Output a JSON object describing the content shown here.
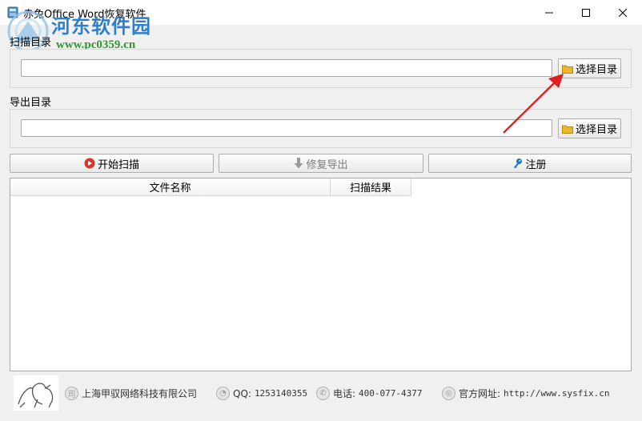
{
  "window": {
    "title": "赤兔Office Word恢复软件",
    "controls": {
      "minimize": "—",
      "maximize": "☐",
      "close": "✕"
    }
  },
  "watermark": {
    "site_name": "河东软件园",
    "site_url": "www.pc0359.cn"
  },
  "scan_dir": {
    "label": "扫描目录",
    "value": "",
    "browse_label": "选择目录"
  },
  "export_dir": {
    "label": "导出目录",
    "value": "",
    "browse_label": "选择目录"
  },
  "actions": {
    "start_scan": "开始扫描",
    "repair_export": "修复导出",
    "register": "注册"
  },
  "table": {
    "columns": [
      "文件名称",
      "扫描结果"
    ],
    "rows": []
  },
  "footer": {
    "company": "上海甲驭网络科技有限公司",
    "qq_label": "QQ:",
    "qq": "1253140355",
    "phone_label": "电话:",
    "phone": "400-077-4377",
    "website_label": "官方网址:",
    "website": "http://www.sysfix.cn"
  },
  "colors": {
    "title_bar": "#ffffff",
    "window_bg": "#f0f0f0",
    "watermark_blue": "#2e7ec9",
    "watermark_green": "#2a9a2a",
    "annotation_arrow": "#e02020",
    "start_icon": "#d9362b",
    "register_icon": "#1e74c8",
    "folder_icon": "#e9b82c"
  }
}
